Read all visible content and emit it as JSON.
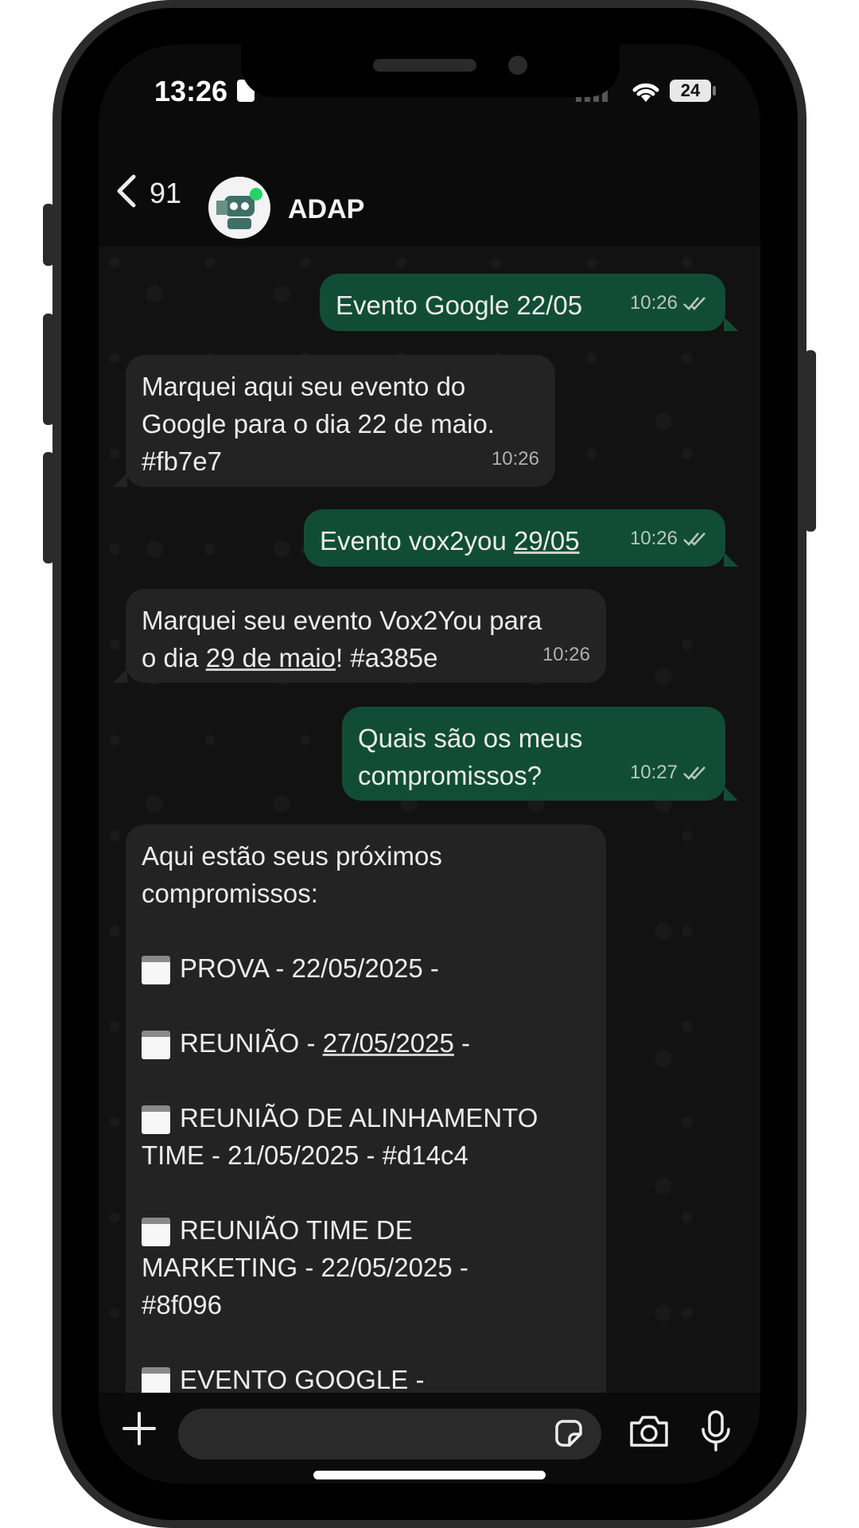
{
  "status_bar": {
    "time": "13:26",
    "battery": "24"
  },
  "header": {
    "back_count": "91",
    "contact_name": "ADAP"
  },
  "messages": [
    {
      "dir": "out",
      "text": "Evento Google 22/05",
      "time": "10:26"
    },
    {
      "dir": "in",
      "line1": "Marquei aqui seu evento do",
      "line2": "Google para o dia 22 de maio.",
      "line3": "#fb7e7",
      "time": "10:26"
    },
    {
      "dir": "out",
      "prefix": "Evento vox2you ",
      "link": "29/05",
      "time": "10:26"
    },
    {
      "dir": "in",
      "line1": "Marquei seu evento Vox2You para",
      "prefix2": "o dia ",
      "link": "29 de maio",
      "suffix2": "! #a385e",
      "time": "10:26"
    },
    {
      "dir": "out",
      "line1": "Quais são os meus",
      "line2": "compromissos?",
      "time": "10:27"
    },
    {
      "dir": "in",
      "line1": "Aqui estão seus próximos",
      "line2": "compromissos:",
      "items": [
        {
          "text": "PROVA - 22/05/2025 -"
        },
        {
          "prefix": "REUNIÃO - ",
          "link": "27/05/2025",
          "suffix": " -"
        },
        {
          "line1": "REUNIÃO DE ALINHAMENTO",
          "line2": "TIME - 21/05/2025 - #d14c4"
        },
        {
          "line1": "REUNIÃO TIME DE",
          "line2": "MARKETING - 22/05/2025 -",
          "line3": "#8f096"
        },
        {
          "text": "EVENTO GOOGLE -"
        }
      ]
    }
  ],
  "icons": [
    "back-chevron-icon",
    "plus-icon",
    "sticker-icon",
    "camera-icon",
    "microphone-icon",
    "double-check-icon",
    "calendar-icon",
    "wifi-icon",
    "signal-icon",
    "battery-icon"
  ],
  "colors": {
    "outgoing_bubble": "#114d36",
    "incoming_bubble": "#232323",
    "background": "#121212"
  }
}
